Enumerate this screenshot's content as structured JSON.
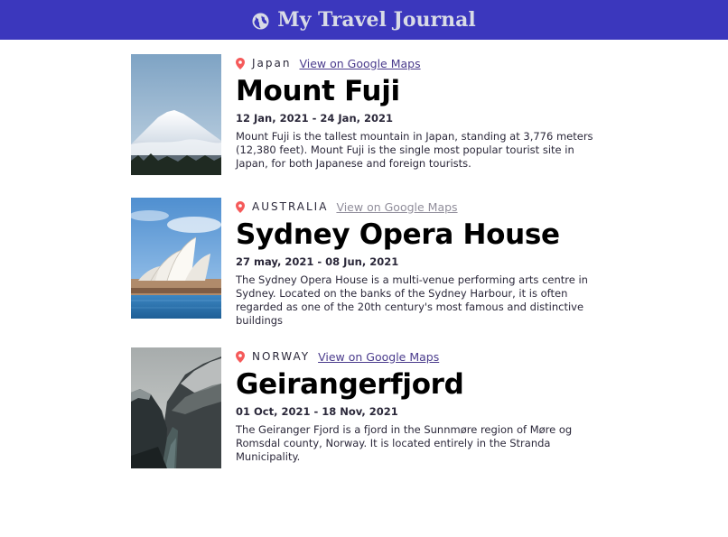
{
  "header": {
    "title": "My Travel Journal",
    "icon": "globe-icon",
    "background": "#3b37bd",
    "text_color": "#d8dbe6"
  },
  "entries": [
    {
      "country": "Japan",
      "map_link_label": "View on Google Maps",
      "title": "Mount Fuji",
      "dates": "12 Jan, 2021 - 24 Jan, 2021",
      "description": "Mount Fuji is the tallest mountain in Japan, standing at 3,776 meters (12,380 feet). Mount Fuji is the single most popular tourist site in Japan, for both Japanese and foreign tourists."
    },
    {
      "country": "AUSTRALIA",
      "map_link_label": "View on Google Maps",
      "title": "Sydney Opera House",
      "dates": "27 may, 2021 - 08 Jun, 2021",
      "description": "The Sydney Opera House is a multi-venue performing arts centre in Sydney. Located on the banks of the Sydney Harbour, it is often regarded as one of the 20th century's most famous and distinctive buildings"
    },
    {
      "country": "NORWAY",
      "map_link_label": "View on Google Maps",
      "title": "Geirangerfjord",
      "dates": "01 Oct, 2021 - 18 Nov, 2021",
      "description": "The Geiranger Fjord is a fjord in the Sunnmøre region of Møre og Romsdal county, Norway. It is located entirely in the Stranda Municipality."
    }
  ],
  "colors": {
    "pin": "#f55a5a",
    "link": "#4a3b8c",
    "link_faded": "#918e9b"
  }
}
